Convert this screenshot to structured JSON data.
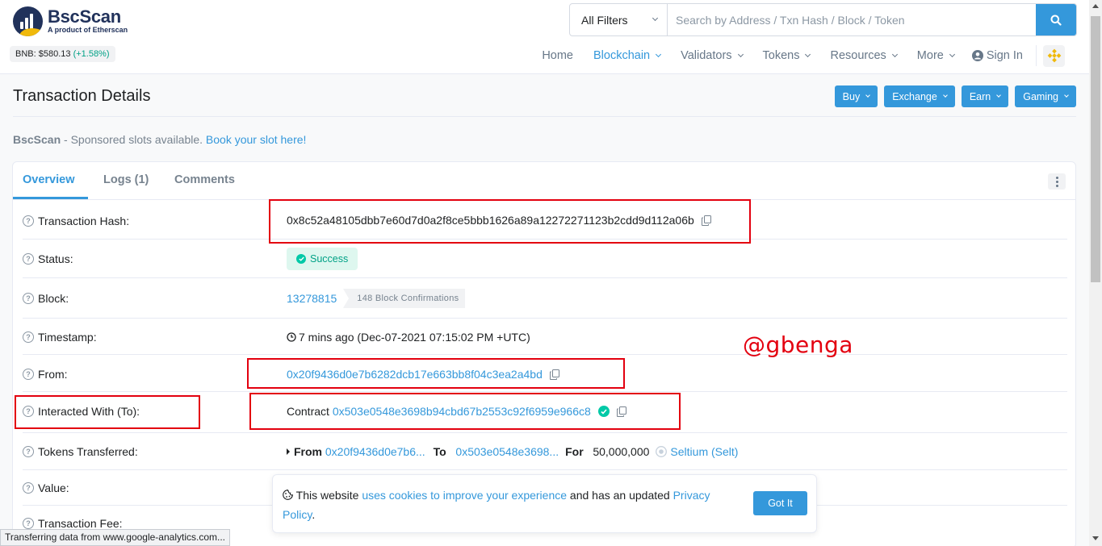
{
  "header": {
    "logo_title": "BscScan",
    "logo_sub": "A product of Etherscan",
    "bnb_label": "BNB: $580.13",
    "bnb_change": "(+1.58%)",
    "filter_label": "All Filters",
    "search_placeholder": "Search by Address / Txn Hash / Block / Token",
    "nav": {
      "home": "Home",
      "blockchain": "Blockchain",
      "validators": "Validators",
      "tokens": "Tokens",
      "resources": "Resources",
      "more": "More",
      "signin": "Sign In"
    }
  },
  "page": {
    "title": "Transaction Details",
    "buttons": {
      "buy": "Buy",
      "exchange": "Exchange",
      "earn": "Earn",
      "gaming": "Gaming"
    },
    "sponsor": {
      "brand": "BscScan",
      "text": " - Sponsored slots available. ",
      "link": "Book your slot here!"
    }
  },
  "tabs": {
    "overview": "Overview",
    "logs": "Logs (1)",
    "comments": "Comments"
  },
  "details": {
    "tx_hash_label": "Transaction Hash:",
    "tx_hash": "0x8c52a48105dbb7e60d7d0a2f8ce5bbb1626a89a12272271123b2cdd9d112a06b",
    "status_label": "Status:",
    "status": "Success",
    "block_label": "Block:",
    "block": "13278815",
    "confirmations": "148 Block Confirmations",
    "timestamp_label": "Timestamp:",
    "timestamp": "7 mins ago (Dec-07-2021 07:15:02 PM +UTC)",
    "from_label": "From:",
    "from": "0x20f9436d0e7b6282dcb17e663bb8f04c3ea2a4bd",
    "to_label": "Interacted With (To):",
    "to_prefix": "Contract",
    "to": "0x503e0548e3698b94cbd67b2553c92f6959e966c8",
    "tokens_label": "Tokens Transferred:",
    "tokens_from_kw": "From",
    "tokens_from": "0x20f9436d0e7b6...",
    "tokens_to_kw": "To",
    "tokens_to": "0x503e0548e3698...",
    "tokens_for_kw": "For",
    "tokens_amount": "50,000,000",
    "tokens_name": "Seltium (Selt)",
    "value_label": "Value:",
    "fee_label": "Transaction Fee:"
  },
  "watermark": "@gbenga",
  "cookie": {
    "text1": " This website ",
    "link1": "uses cookies to improve your experience",
    "text2": " and has an updated ",
    "link2": "Privacy Policy",
    "text3": ".",
    "button": "Got It"
  },
  "statusbar": "Transferring data from www.google-analytics.com...",
  "colors": {
    "primary": "#3498db",
    "success": "#00a186",
    "annotation_red": "#e3000f",
    "navy": "#21325b",
    "bnb_yellow": "#f0b90b"
  }
}
